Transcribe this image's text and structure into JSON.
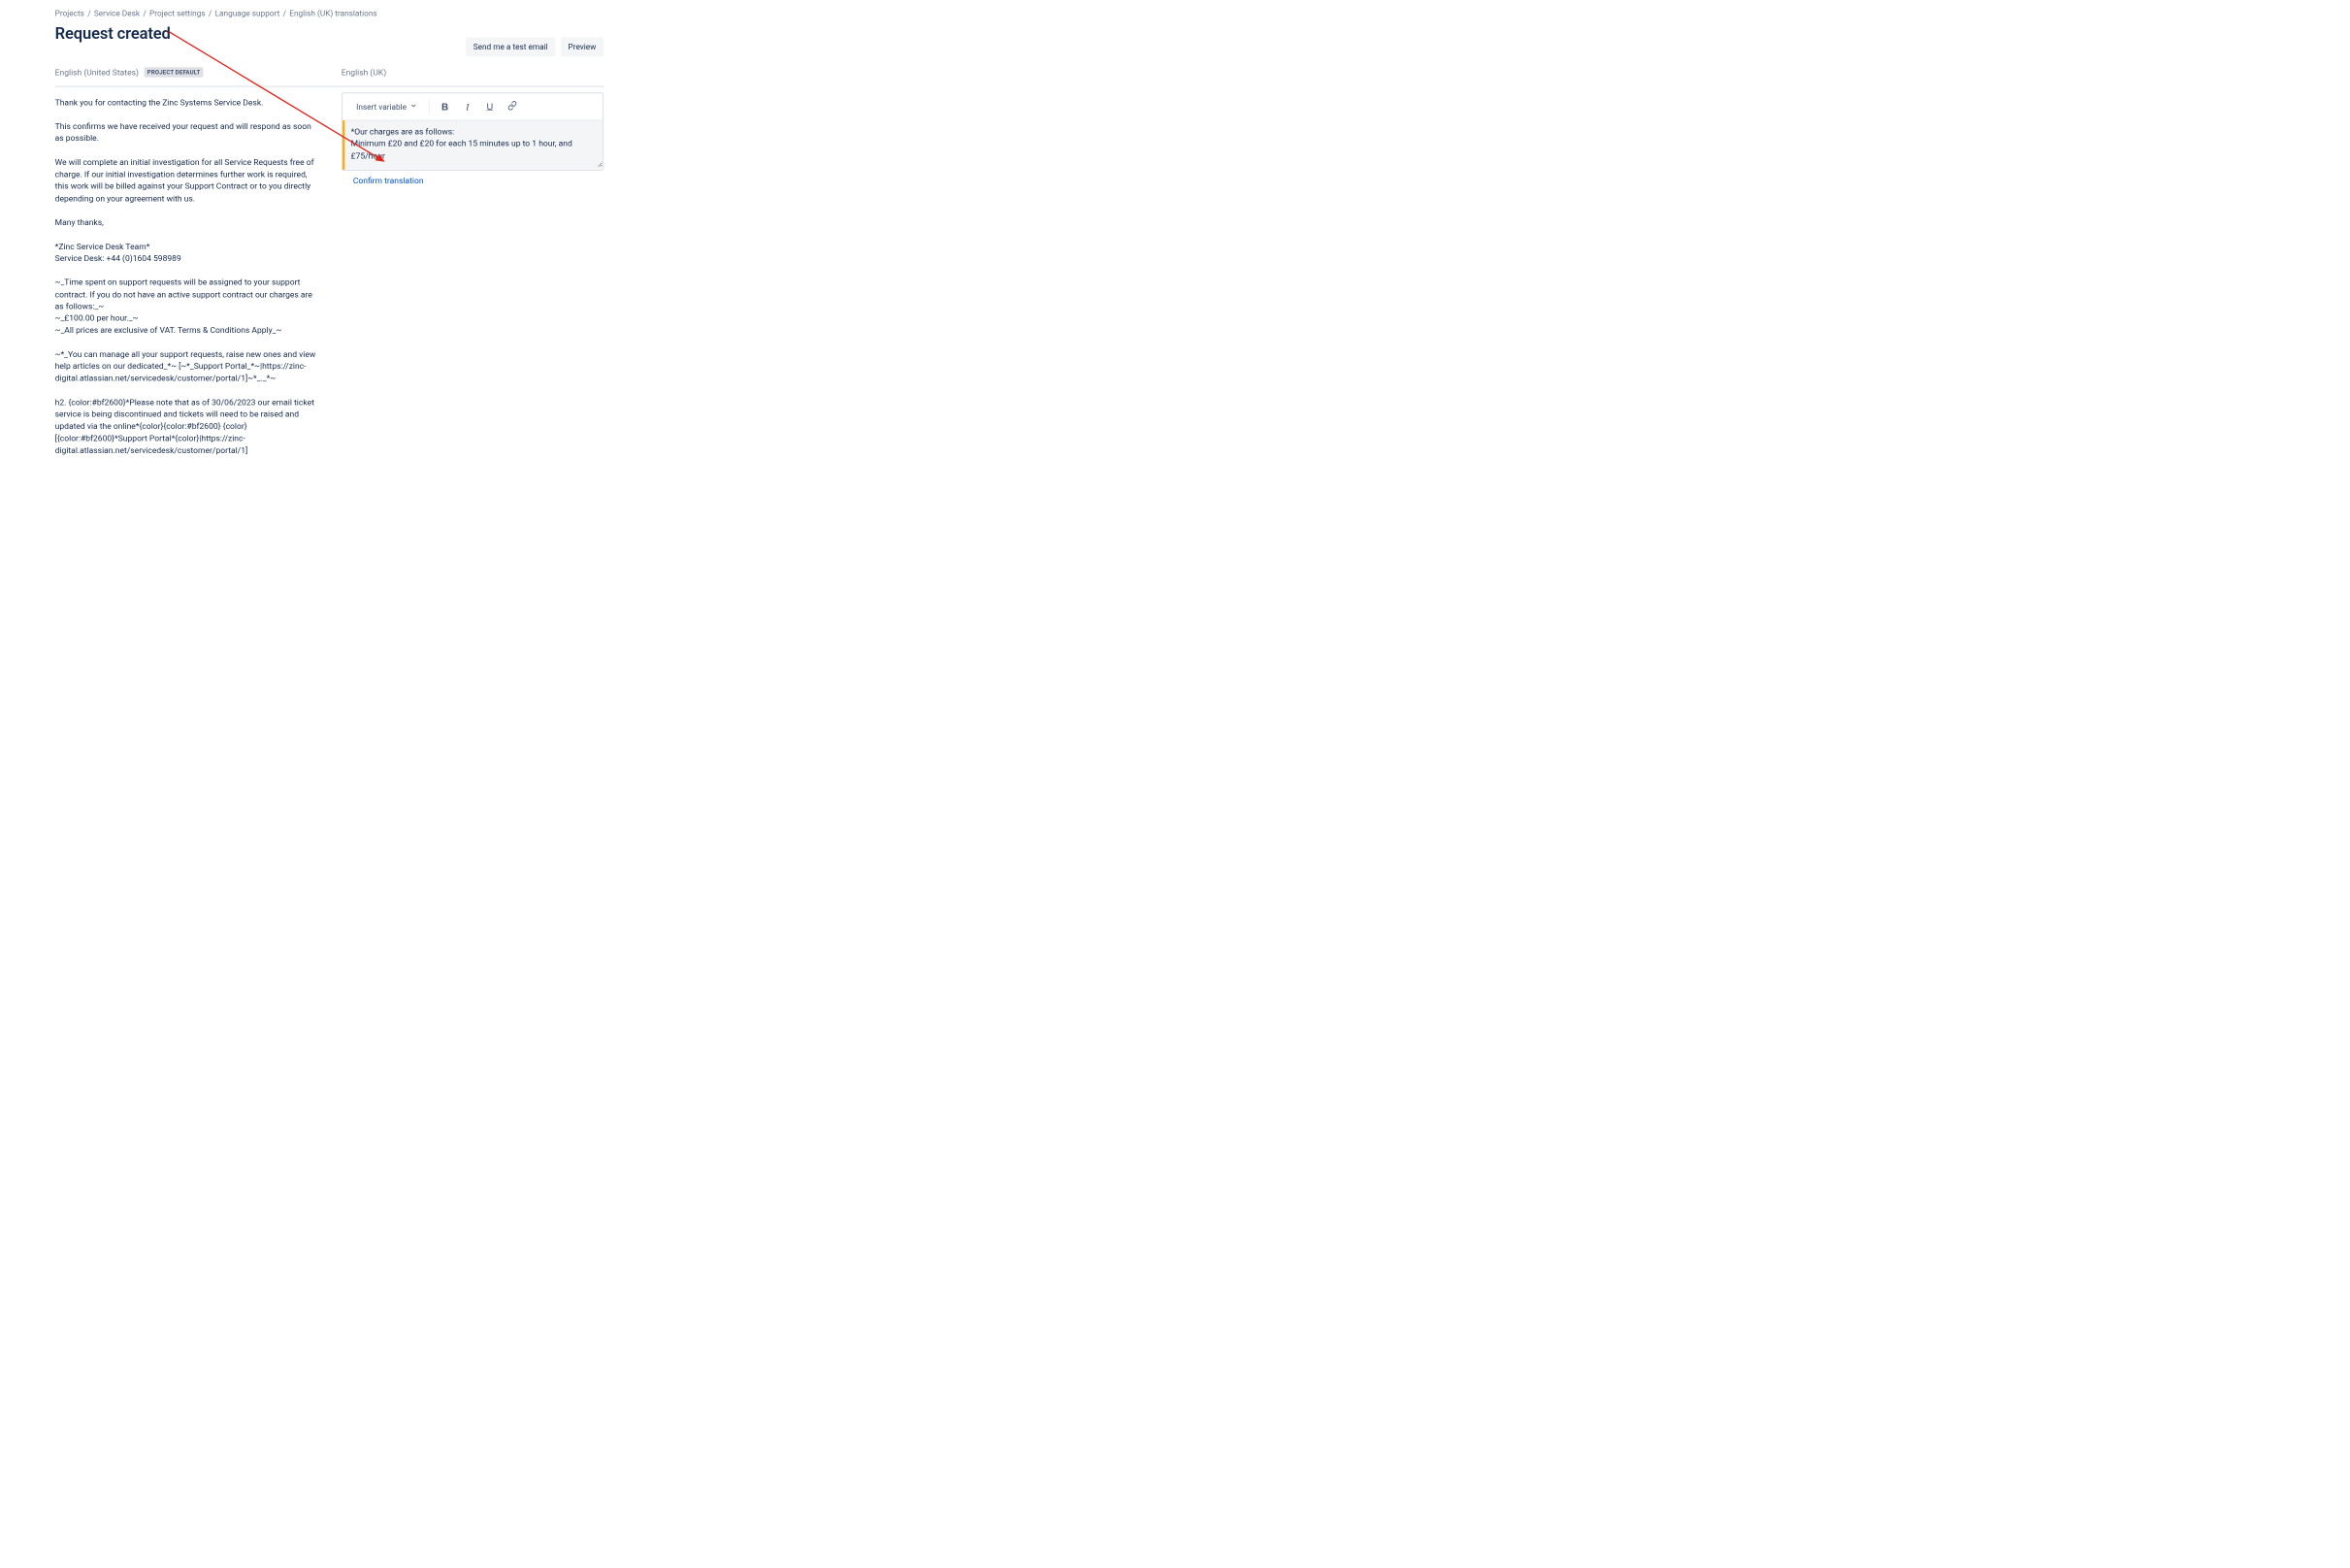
{
  "breadcrumbs": {
    "crumb0": "Projects",
    "crumb1": "Service Desk",
    "crumb2": "Project settings",
    "crumb3": "Language support",
    "crumb4": "English (UK) translations"
  },
  "page_title": "Request created",
  "actions": {
    "send_test": "Send me a test email",
    "preview": "Preview"
  },
  "columns": {
    "source": {
      "lang_label": "English (United States)",
      "badge": "PROJECT DEFAULT",
      "body": "Thank you for contacting the Zinc Systems Service Desk.\n\nThis confirms we have received your request and will respond as soon as possible.\n\nWe will complete an initial investigation for all Service Requests free of charge. If our initial investigation determines further work is required, this work will be billed against your Support Contract or to you directly depending on your agreement with us.\n\nMany thanks,\n\n*Zinc Service Desk Team*\nService Desk: +44 (0)1604 598989\n\n~_Time spent on support requests will be assigned to your support contract. If you do not have an active support contract our charges are as follows:_~\n~_£100.00 per hour._~\n~_All prices are exclusive of VAT. Terms & Conditions Apply_~\n\n~*_You can manage all your support requests, raise new ones and view help articles on our dedicated_*~ [~*_Support Portal_*~|https://zinc-digital.atlassian.net/servicedesk/customer/portal/1]~*_._*~\n\nh2. {color:#bf2600}*Please note that as of 30/06/2023 our email ticket service is being discontinued and tickets will need to be raised and updated via the online*{color}{color:#bf2600} {color}[{color:#bf2600}*Support Portal*{color}|https://zinc-digital.atlassian.net/servicedesk/customer/portal/1]"
    },
    "target": {
      "lang_label": "English (UK)",
      "toolbar": {
        "insert_variable": "Insert variable"
      },
      "editor_value": "*Our charges are as follows:\nMinimum £20 and £20 for each 15 minutes up to 1 hour, and £75/hour",
      "confirm_label": "Confirm translation"
    }
  }
}
